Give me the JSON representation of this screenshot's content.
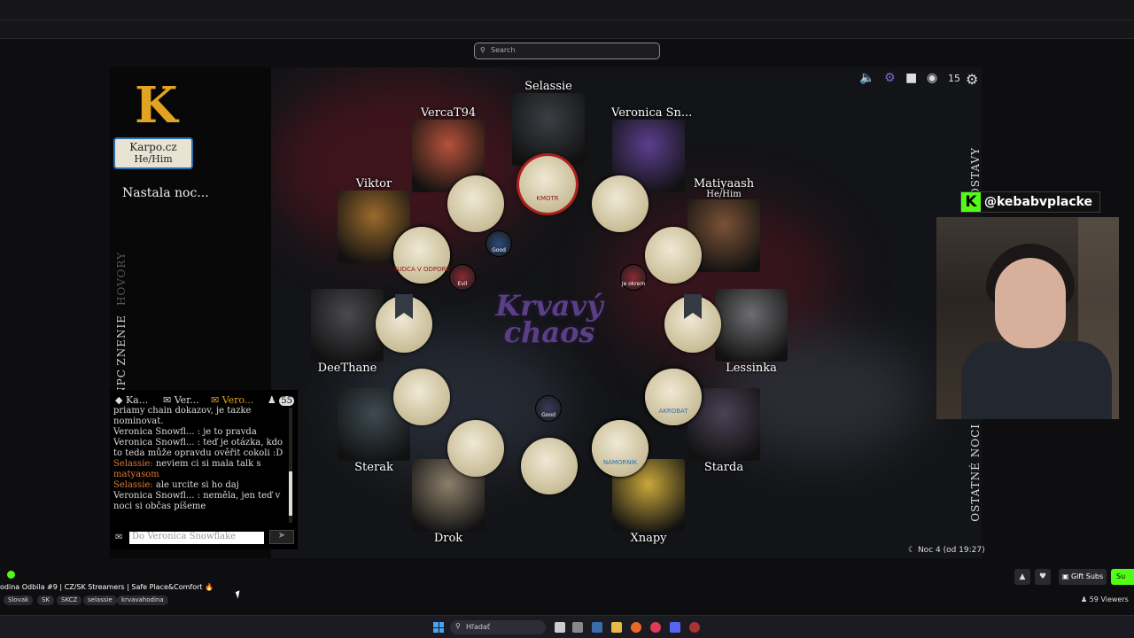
{
  "search": {
    "placeholder": "Search"
  },
  "sidebar": {
    "logo_letter": "K",
    "badge_name": "Karpo.cz",
    "badge_pronouns": "He/Him",
    "night_text": "Nastala noc...",
    "tabs": [
      "HOVORY",
      "ZNENIE",
      "NPC"
    ]
  },
  "chat": {
    "tabs": [
      "Ka...",
      "Ver...",
      "Vero..."
    ],
    "online_count": "55",
    "lines": [
      {
        "speaker": "",
        "text": "priamy chain dokazov, je tazke",
        "color": "#dddddd"
      },
      {
        "speaker": "",
        "text": "nominovat.",
        "color": "#dddddd"
      },
      {
        "speaker": "Veronica Snowfl...",
        "text": " : je to pravda",
        "color": "#dddddd"
      },
      {
        "speaker": "Veronica Snowfl...",
        "text": " : teď je otázka, kdo",
        "color": "#dddddd"
      },
      {
        "speaker": "",
        "text": "to teda může opravdu ověřit cokoli :D",
        "color": "#dddddd"
      },
      {
        "speaker": "Selassie:",
        "text": " neviem ci si mala talk s",
        "color": "#e07a36"
      },
      {
        "speaker": "",
        "text": "matyasom",
        "color": "#e07a36"
      },
      {
        "speaker": "Selassie:",
        "text": " ale urcite si ho daj",
        "color": "#e07a36"
      },
      {
        "speaker": "Veronica Snowfl...",
        "text": " : neměla, jen teď v",
        "color": "#dddddd"
      },
      {
        "speaker": "",
        "text": "noci si občas píšeme",
        "color": "#dddddd"
      }
    ],
    "input_placeholder": "Do Veronica Snowflake"
  },
  "game": {
    "title_line1": "Krvavý",
    "title_line2": "chaos",
    "players": [
      {
        "name": "Selassie",
        "pronouns": "",
        "color": "#3b3f44"
      },
      {
        "name": "VercaT94",
        "pronouns": "",
        "color": "#b5523a"
      },
      {
        "name": "Veronica Sn...",
        "pronouns": "",
        "color": "#5b3f8e"
      },
      {
        "name": "Viktor",
        "pronouns": "",
        "color": "#9b6a2b"
      },
      {
        "name": "Matiyaash",
        "pronouns": "He/Him",
        "color": "#7a5236"
      },
      {
        "name": "DeeThane",
        "pronouns": "",
        "color": "#4a4a4f"
      },
      {
        "name": "Lessinka",
        "pronouns": "",
        "color": "#6e6e72"
      },
      {
        "name": "Sterak",
        "pronouns": "",
        "color": "#3e4a52"
      },
      {
        "name": "Starda",
        "pronouns": "",
        "color": "#4b4256"
      },
      {
        "name": "Drok",
        "pronouns": "",
        "color": "#8c7f6a"
      },
      {
        "name": "Xnapy",
        "pronouns": "",
        "color": "#c9a83a"
      }
    ],
    "token_labels": [
      "KMOTR",
      "SUDCA V ODPORE",
      "AKROBAT",
      "NÁMORNÍK"
    ],
    "mini_labels": [
      "Good",
      "Evil",
      "Je okrem",
      "Good"
    ]
  },
  "controls": {
    "icons": [
      "volume-icon",
      "mic-muted-icon",
      "camera-icon",
      "wifi-icon",
      "gear-icon"
    ],
    "counter": "15"
  },
  "right_vertical": {
    "top": "POSTAVY",
    "bottom": "OSTATNÉ NOCI"
  },
  "night_status": "Noc 4 (od 19:27)",
  "overlay": {
    "handle": "@kebabvplacke",
    "k_letter": "K"
  },
  "kick": {
    "stream_title": "odina Odbila #9 | CZ/SK Streamers | Safe Place&Comfort 🔥",
    "tags": [
      "Slovak",
      "SK",
      "SKCZ",
      "selassie",
      "krvavahodina"
    ],
    "gift_label": "Gift Subs",
    "sub_label": "Su",
    "viewers": "59 Viewers"
  },
  "taskbar": {
    "search_placeholder": "Hľadať"
  },
  "colors": {
    "kick_green": "#53fc18",
    "accent_orange": "#e07a36"
  }
}
